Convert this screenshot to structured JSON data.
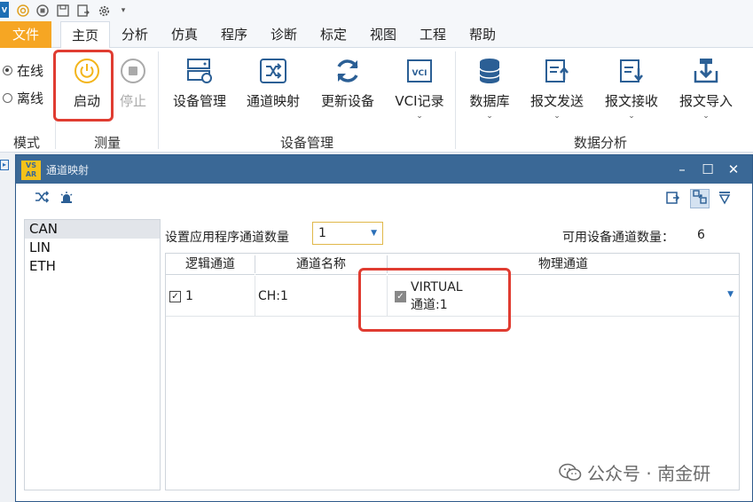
{
  "quick_access": {
    "icons": [
      "app-logo-icon",
      "target-icon",
      "stop-circle-icon",
      "save-icon",
      "save-as-icon",
      "settings-icon",
      "customize-dropdown-icon"
    ]
  },
  "menu": {
    "file": "文件",
    "tabs": [
      "主页",
      "分析",
      "仿真",
      "程序",
      "诊断",
      "标定",
      "视图",
      "工程",
      "帮助"
    ]
  },
  "ribbon": {
    "mode": {
      "online": "在线",
      "offline": "离线",
      "selected": "online",
      "label": "模式"
    },
    "measure": {
      "start": "启动",
      "stop": "停止",
      "label": "测量"
    },
    "device": {
      "manage": "设备管理",
      "mapping": "通道映射",
      "refresh": "更新设备",
      "vci": "VCI记录",
      "label": "设备管理"
    },
    "analysis": {
      "database": "数据库",
      "send": "报文发送",
      "receive": "报文接收",
      "import": "报文导入",
      "label": "数据分析"
    }
  },
  "dialog": {
    "title": "通道映射",
    "logo_text": "VS AR",
    "bus_list": [
      "CAN",
      "LIN",
      "ETH"
    ],
    "selected_bus": "CAN",
    "setting_label": "设置应用程序通道数量",
    "channel_count": "1",
    "available_label": "可用设备通道数量：",
    "available_count": "6",
    "columns": [
      "逻辑通道",
      "通道名称",
      "物理通道"
    ],
    "rows": [
      {
        "logic": "1",
        "logic_checked": true,
        "name": "CH:1",
        "physical_line1": "VIRTUAL",
        "physical_line2": "通道:1",
        "physical_checked": true
      }
    ]
  },
  "watermark": {
    "text": "公众号 · 南金研"
  },
  "colors": {
    "accent": "#f6a623",
    "title_bar": "#3a6896",
    "highlight": "#e03c31",
    "icon_blue": "#2b5f95"
  }
}
